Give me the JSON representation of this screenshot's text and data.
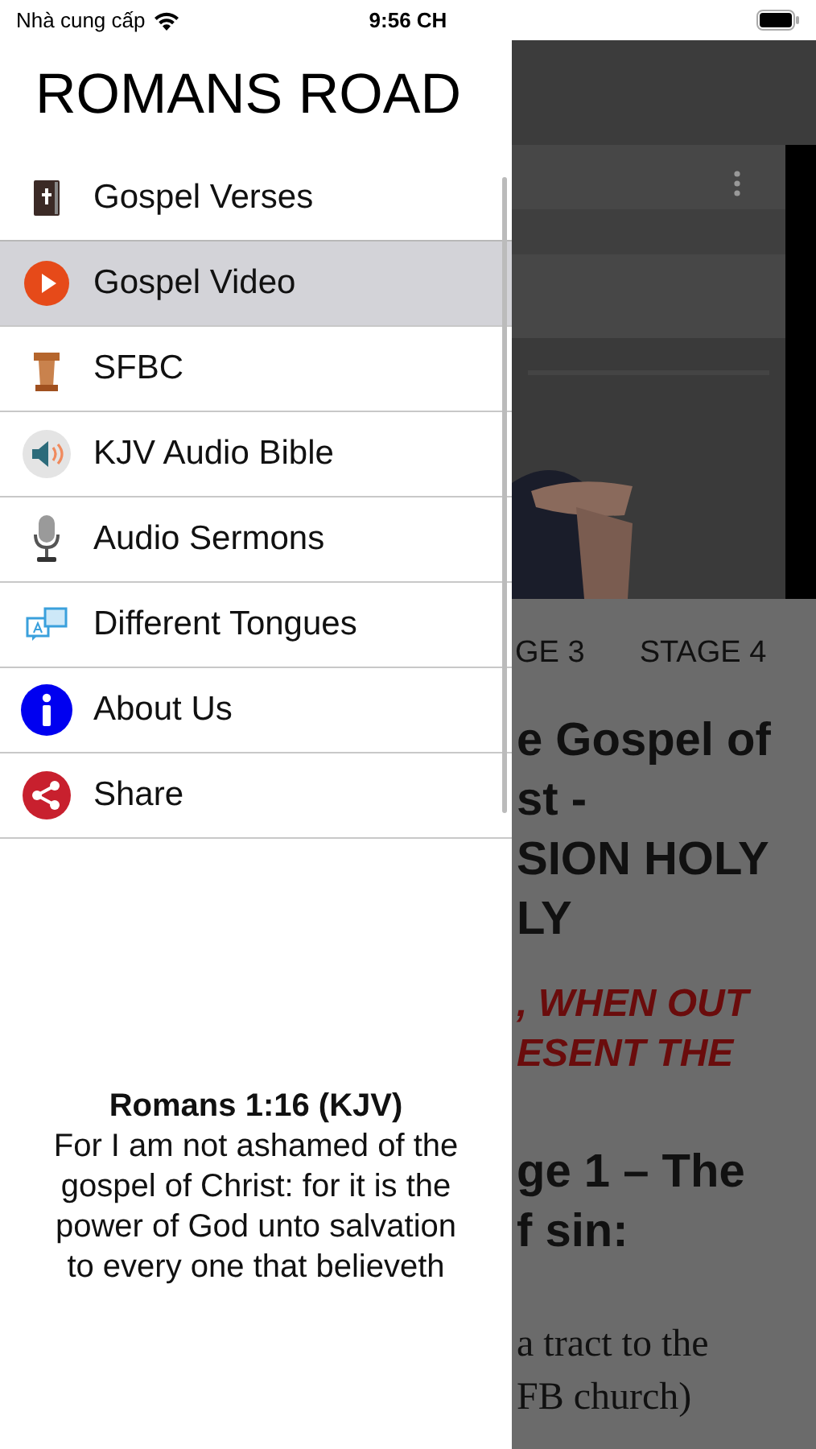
{
  "status_bar": {
    "carrier": "Nhà cung cấp",
    "time": "9:56 CH"
  },
  "drawer": {
    "title": "ROMANS ROAD",
    "items": [
      {
        "label": "Gospel Verses",
        "kind": "bible",
        "selected": false
      },
      {
        "label": "Gospel Video",
        "kind": "play",
        "selected": true
      },
      {
        "label": "SFBC",
        "kind": "pulpit",
        "selected": false
      },
      {
        "label": "KJV Audio Bible",
        "kind": "speaker",
        "selected": false
      },
      {
        "label": "Audio Sermons",
        "kind": "microphone",
        "selected": false
      },
      {
        "label": "Different Tongues",
        "kind": "translate",
        "selected": false
      },
      {
        "label": "About Us",
        "kind": "info",
        "selected": false
      },
      {
        "label": "Share",
        "kind": "share",
        "selected": false
      }
    ],
    "verse": {
      "reference": "Romans 1:16 (KJV)",
      "text": "For I am not ashamed of the gospel of Christ: for it is the power of God unto salvation to every one that believeth"
    }
  },
  "background": {
    "tabs": [
      {
        "label": "GE 3"
      },
      {
        "label": "STAGE 4"
      }
    ],
    "article": [
      {
        "kind": "heading",
        "lines": [
          "e Gospel of",
          "st -",
          "SION HOLY",
          "LY"
        ]
      },
      {
        "kind": "highlight",
        "lines": [
          ", WHEN OUT",
          "ESENT THE"
        ]
      },
      {
        "kind": "heading",
        "lines": [
          "ge 1 – The",
          "f sin:"
        ]
      },
      {
        "kind": "body",
        "lines": [
          "a tract to the",
          "FB church)"
        ]
      }
    ]
  }
}
